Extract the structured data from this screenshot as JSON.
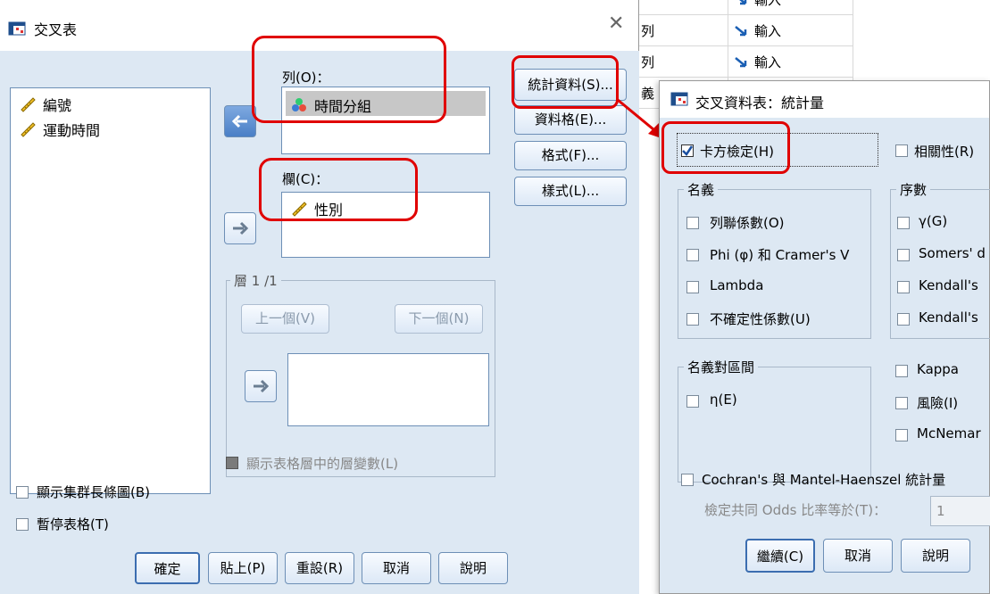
{
  "background": {
    "rows": [
      {
        "a": "",
        "b": "輸入"
      },
      {
        "a": "列",
        "b": "輸入"
      },
      {
        "a": "列",
        "b": "輸入"
      },
      {
        "a": "義",
        "b": ""
      }
    ]
  },
  "crosstabs": {
    "title": "交叉表",
    "variables": [
      "編號",
      "運動時間"
    ],
    "rows_label": "列(O)：",
    "rows_items": [
      "時間分組"
    ],
    "cols_label": "欄(C)：",
    "cols_items": [
      "性別"
    ],
    "layer_label": "層 1 /1",
    "prev_label": "上一個(V)",
    "next_label": "下一個(N)",
    "show_layer_label": "顯示表格層中的層變數(L)",
    "clustered_bar_label": "顯示集群長條圖(B)",
    "suppress_tables_label": "暫停表格(T)",
    "side_buttons": [
      "統計資料(S)...",
      "資料格(E)...",
      "格式(F)...",
      "樣式(L)..."
    ],
    "bottom_buttons": [
      "確定",
      "貼上(P)",
      "重設(R)",
      "取消",
      "說明"
    ]
  },
  "stats": {
    "title": "交叉資料表：統計量",
    "chi_square": "卡方檢定(H)",
    "correlations": "相關性(R)",
    "nominal_title": "名義",
    "nominal": [
      "列聯係數(O)",
      "Phi (φ) 和 Cramer's V",
      "Lambda",
      "不確定性係數(U)"
    ],
    "ordinal_title": "序數",
    "ordinal": [
      "γ(G)",
      "Somers' d",
      "Kendall's",
      "Kendall's"
    ],
    "interval_title": "名義對區間",
    "interval": [
      "η(E)"
    ],
    "extra": [
      "Kappa",
      "風險(I)",
      "McNemar"
    ],
    "cmh_label": "Cochran's 與 Mantel-Haenszel 統計量",
    "odds_label": "檢定共同 Odds 比率等於(T)：",
    "odds_value": "1",
    "buttons": [
      "繼續(C)",
      "取消",
      "說明"
    ]
  },
  "colors": {
    "accent_red": "#e00000",
    "dialog_bg": "#dde8f3"
  }
}
